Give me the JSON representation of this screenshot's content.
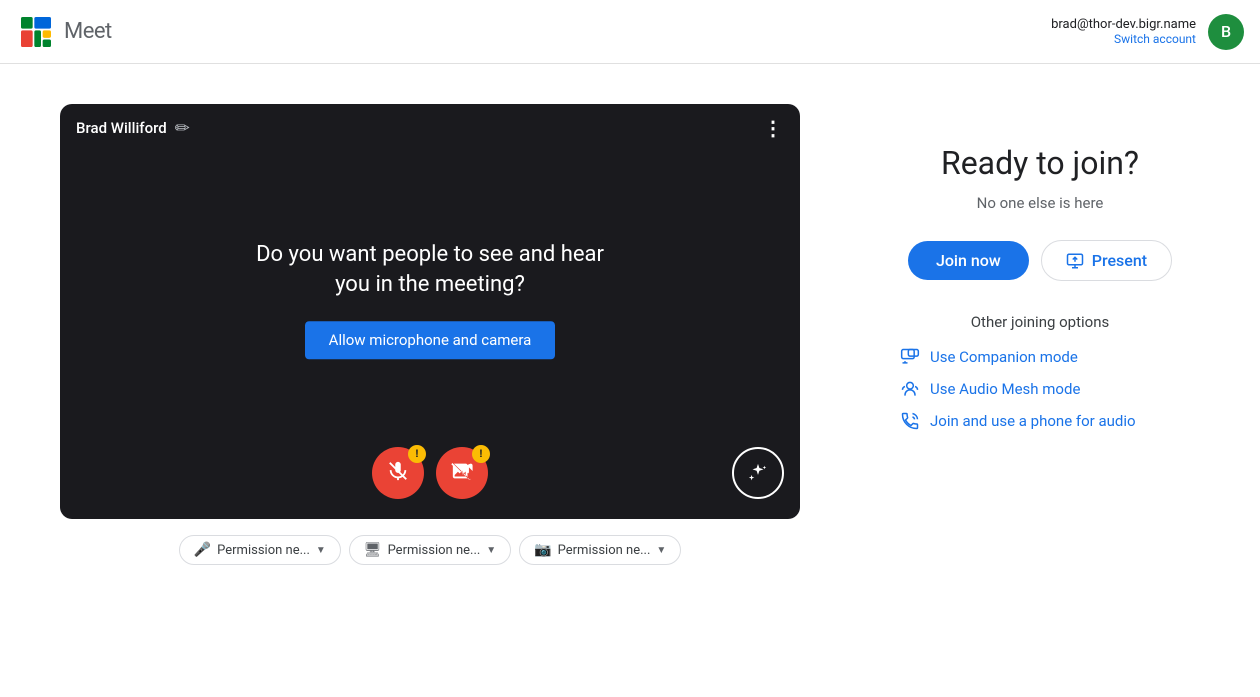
{
  "header": {
    "app_name": "Meet",
    "account_email": "brad@thor-dev.bigr.name",
    "switch_account_label": "Switch account",
    "avatar_letter": "B",
    "avatar_bg": "#1e8e3e"
  },
  "video_preview": {
    "user_name": "Brad Williford",
    "center_question": "Do you want people to see and hear you in the meeting?",
    "allow_btn_label": "Allow microphone and camera",
    "controls": {
      "mic_label": "Microphone off",
      "camera_label": "Camera off",
      "effects_label": "Effects"
    }
  },
  "permissions": {
    "mic_label": "Permission ne...",
    "screen_label": "Permission ne...",
    "camera_label": "Permission ne..."
  },
  "right_panel": {
    "ready_title": "Ready to join?",
    "no_one_text": "No one else is here",
    "join_now_label": "Join now",
    "present_label": "Present",
    "other_options_title": "Other joining options",
    "options": [
      {
        "label": "Use Companion mode",
        "icon": "companion"
      },
      {
        "label": "Use Audio Mesh mode",
        "icon": "audio-mesh"
      },
      {
        "label": "Join and use a phone for audio",
        "icon": "phone"
      }
    ]
  }
}
